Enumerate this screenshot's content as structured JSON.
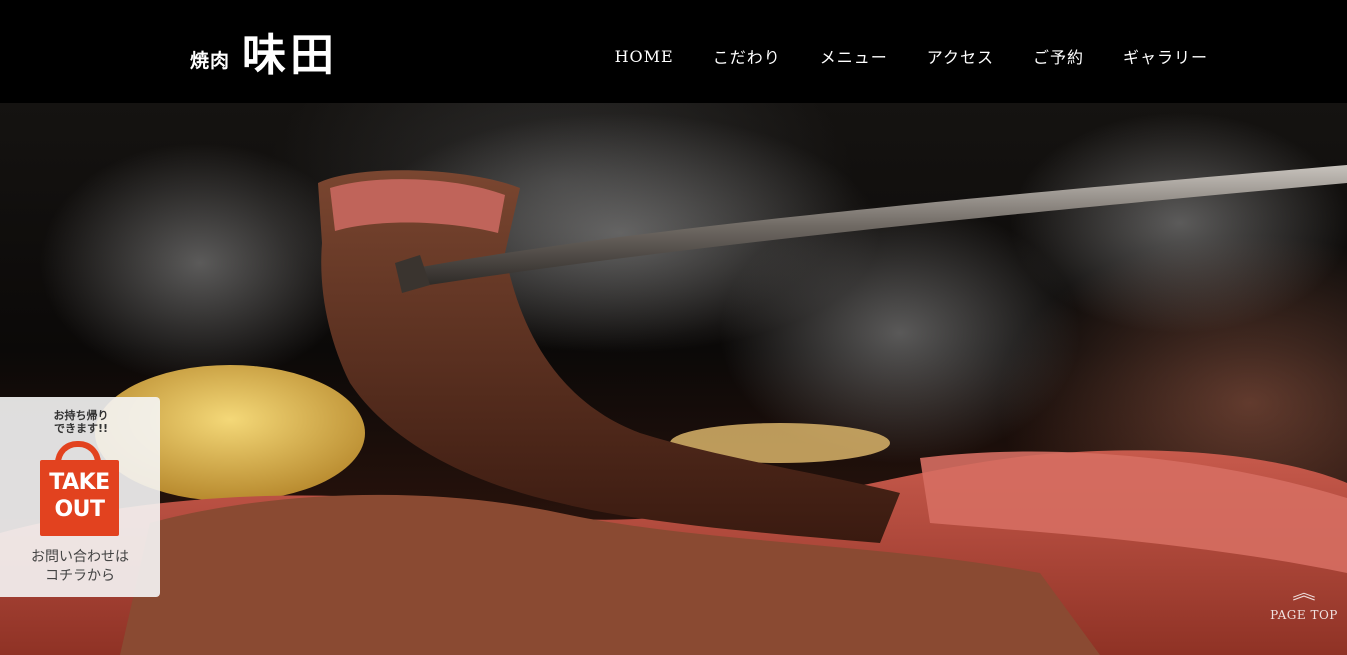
{
  "brand": {
    "logo_small": "焼肉",
    "logo_large": "味田"
  },
  "nav": {
    "items": [
      {
        "label": "HOME"
      },
      {
        "label": "こだわり"
      },
      {
        "label": "メニュー"
      },
      {
        "label": "アクセス"
      },
      {
        "label": "ご予約"
      },
      {
        "label": "ギャラリー"
      }
    ]
  },
  "takeout": {
    "tag_line1": "お持ち帰り",
    "tag_line2": "できます!!",
    "bag_line1": "TAKE",
    "bag_line2": "OUT",
    "caption_line1": "お問い合わせは",
    "caption_line2": "コチラから",
    "accent_color": "#e2421f"
  },
  "page_top": {
    "icon": "double-chevron-up-icon",
    "label": "PAGE TOP"
  },
  "hero": {
    "image": "grilled-wagyu-with-tongs"
  }
}
